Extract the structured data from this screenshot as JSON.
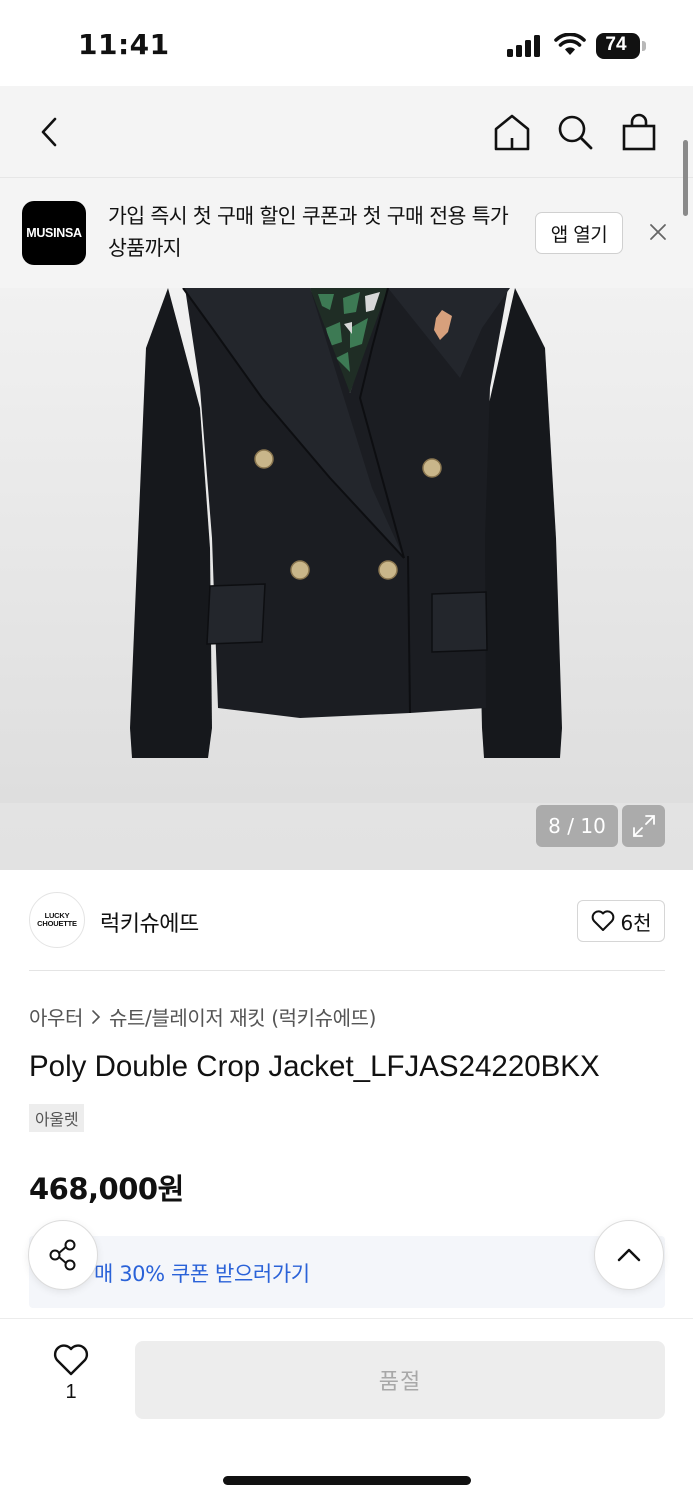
{
  "status_bar": {
    "time": "11:41",
    "battery": "74"
  },
  "nav": {
    "icons": [
      "chevron-left-icon",
      "home-icon",
      "search-icon",
      "shopping-bag-icon"
    ]
  },
  "app_banner": {
    "logo_text": "MUSINSA",
    "message": "가입 즉시 첫 구매 할인 쿠폰과 첫 구매 전용 특가 상품까지",
    "open_label": "앱 열기"
  },
  "gallery": {
    "counter": "8 / 10"
  },
  "brand": {
    "logo_line1": "LUCKY",
    "logo_line2": "CHOUETTE",
    "name": "럭키슈에뜨",
    "likes": "6천"
  },
  "product": {
    "breadcrumb": [
      "아우터",
      "슈트/블레이저 재킷 (럭키슈에뜨)"
    ],
    "title": "Poly Double Crop Jacket_LFJAS24220BKX",
    "badge": "아울렛",
    "price": "468,000원"
  },
  "coupon": {
    "text": "매 30% 쿠폰 받으러가기"
  },
  "bottom_bar": {
    "like_count": "1",
    "buy_label": "품절"
  },
  "colors": {
    "accent_blue": "#2a62d8",
    "jacket": "#1b1d22"
  }
}
